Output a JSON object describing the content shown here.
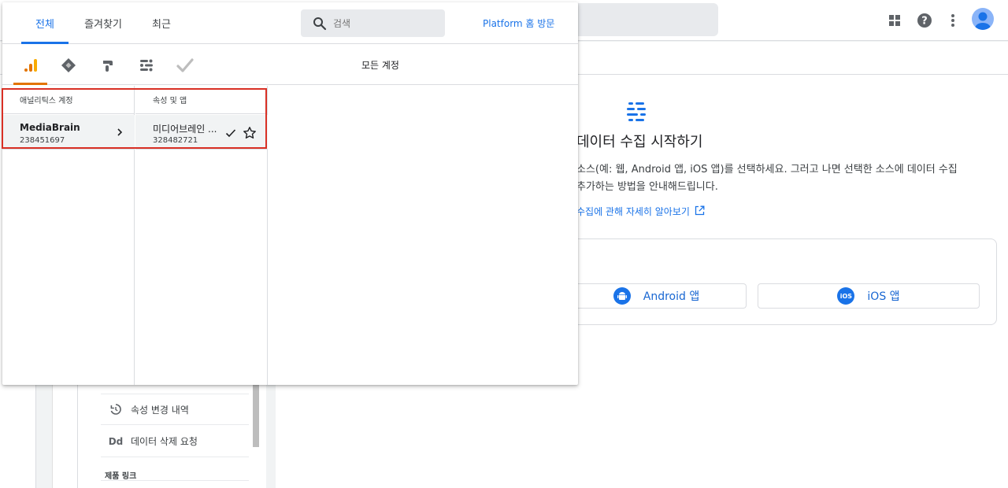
{
  "picker": {
    "tabs": [
      {
        "label": "전체",
        "active": true
      },
      {
        "label": "즐겨찾기",
        "active": false
      },
      {
        "label": "최근",
        "active": false
      }
    ],
    "search_placeholder": "검색",
    "platform_home_label": "Platform 홈 방문",
    "products": [
      {
        "icon": "analytics-icon",
        "active": true
      },
      {
        "icon": "tag-manager-icon",
        "active": false
      },
      {
        "icon": "optimize-icon",
        "active": false
      },
      {
        "icon": "data-studio-icon",
        "active": false
      },
      {
        "icon": "surveys-icon",
        "active": false
      }
    ],
    "all_accounts_label": "모든 계정",
    "accounts_header": "애널리틱스 계정",
    "properties_header": "속성 및 앱",
    "account": {
      "name": "MediaBrain",
      "id": "238451697"
    },
    "property": {
      "name": "미디어브레인 ...",
      "id": "328482721"
    }
  },
  "admin": {
    "history_label": "속성 변경 내역",
    "delete_label": "데이터 삭제 요청",
    "delete_icon_text": "Dd",
    "product_links_label": "제품 링크"
  },
  "main": {
    "title": "데이터 수집 시작하기",
    "desc_line1": "소스(예: 웹, Android 앱, iOS 앱)를 선택하세요. 그러고 나면 선택한 소스에 데이터 수집",
    "desc_line2": "추가하는 방법을 안내해드립니다.",
    "learn_more": "수집에 관해 자세히 알아보기",
    "android_label": "Android 앱",
    "ios_label": "iOS 앱",
    "ios_icon_text": "iOS"
  },
  "colors": {
    "accent": "#1a73e8",
    "analytics_orange": "#e37400",
    "highlight": "#d93025"
  }
}
